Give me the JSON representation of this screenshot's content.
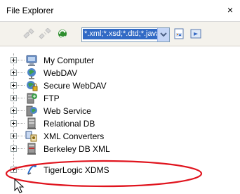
{
  "panel": {
    "title": "File Explorer",
    "close_symbol": "×"
  },
  "toolbar": {
    "icons": [
      "connect-icon",
      "disconnect-icon",
      "refresh-icon",
      "new-file-icon",
      "open-file-icon"
    ],
    "filter_value": "*.xml;*.xsd;*.dtd;*.java;*"
  },
  "tree": {
    "nodes": [
      {
        "label": "My Computer",
        "icon": "computer-icon"
      },
      {
        "label": "WebDAV",
        "icon": "webdav-icon"
      },
      {
        "label": "Secure WebDAV",
        "icon": "secure-webdav-icon"
      },
      {
        "label": "FTP",
        "icon": "ftp-icon"
      },
      {
        "label": "Web Service",
        "icon": "web-service-icon"
      },
      {
        "label": "Relational DB",
        "icon": "database-icon"
      },
      {
        "label": "XML Converters",
        "icon": "xml-converters-icon"
      },
      {
        "label": "Berkeley DB XML",
        "icon": "berkeley-db-icon"
      },
      {
        "label": "TigerLogic XDMS",
        "icon": "tigerlogic-icon"
      }
    ]
  },
  "colors": {
    "highlight_ellipse": "#e0141e",
    "selection": "#316ac5",
    "toolbar_bg": "#f4f2ec"
  }
}
